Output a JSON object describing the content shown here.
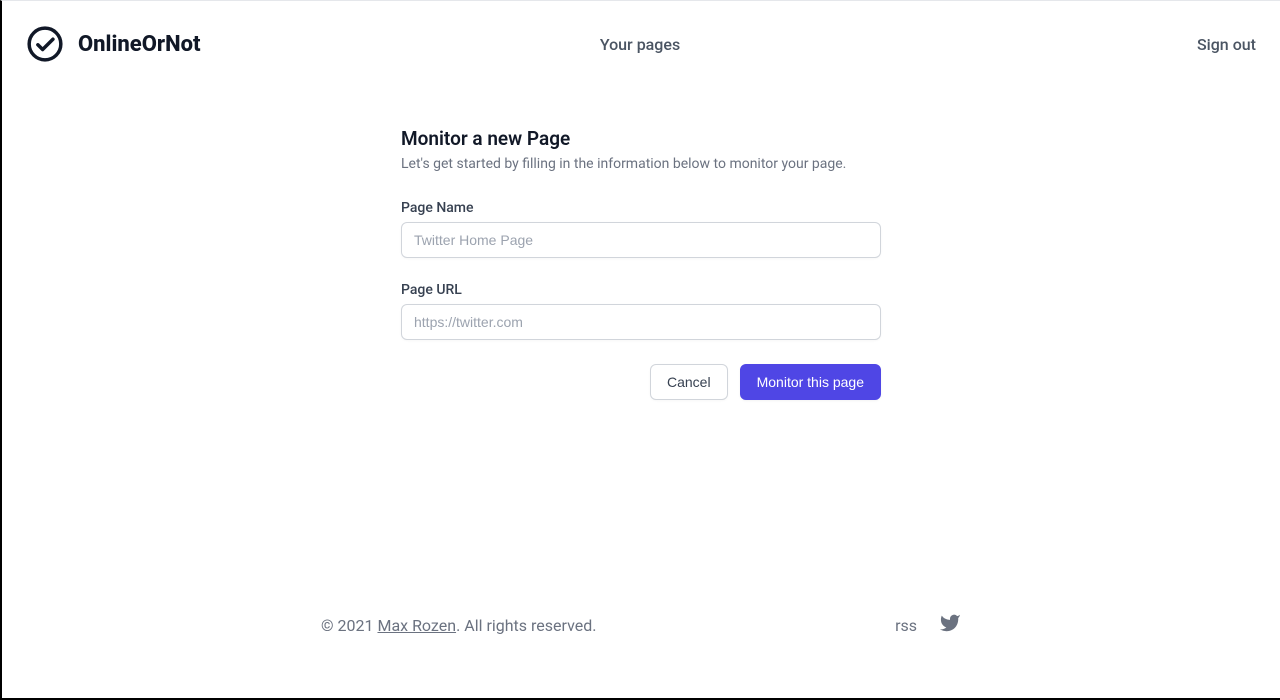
{
  "header": {
    "brand": "OnlineOrNot",
    "nav_pages": "Your pages",
    "sign_out": "Sign out"
  },
  "form": {
    "title": "Monitor a new Page",
    "subtitle": "Let's get started by filling in the information below to monitor your page.",
    "page_name_label": "Page Name",
    "page_name_placeholder": "Twitter Home Page",
    "page_url_label": "Page URL",
    "page_url_placeholder": "https://twitter.com",
    "cancel_label": "Cancel",
    "submit_label": "Monitor this page"
  },
  "footer": {
    "copyright_prefix": "© 2021 ",
    "author": "Max Rozen",
    "copyright_suffix": ". All rights reserved.",
    "rss": "rss"
  }
}
